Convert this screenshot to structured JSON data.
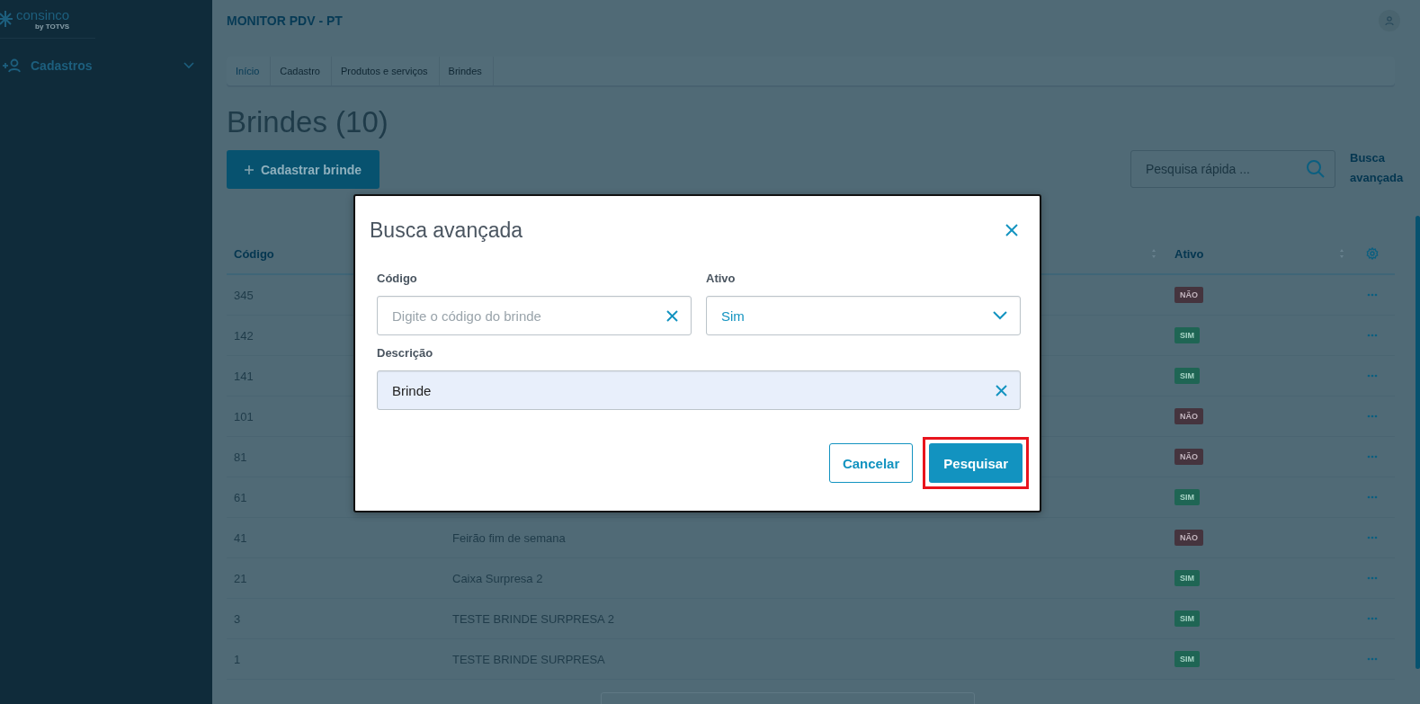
{
  "sidebar": {
    "logo": "consinco",
    "logo_by": "by",
    "logo_brand": "TOTVS",
    "items": [
      {
        "label": "Cadastros",
        "expanded": false
      }
    ]
  },
  "header": {
    "title": "MONITOR PDV - PT"
  },
  "breadcrumb": [
    "Início",
    "Cadastro",
    "Produtos e serviços",
    "Brindes"
  ],
  "page": {
    "title": "Brindes (10)",
    "add_button": "Cadastrar brinde",
    "search": {
      "placeholder": "Pesquisa rápida ..."
    },
    "advanced_link": "Busca avançada"
  },
  "table": {
    "columns": [
      {
        "label": "Código"
      },
      {
        "label": "Ativo",
        "sortable": true
      }
    ],
    "rows": [
      {
        "code": "345",
        "status": "NÃO",
        "active": false
      },
      {
        "code": "142",
        "status": "SIM",
        "active": true
      },
      {
        "code": "141",
        "status": "SIM",
        "active": true
      },
      {
        "code": "101",
        "status": "NÃO",
        "active": false
      },
      {
        "code": "81",
        "status": "NÃO",
        "active": false
      },
      {
        "code": "61",
        "status": "SIM",
        "active": true
      },
      {
        "code": "41",
        "description": "Feirão fim de semana",
        "status": "NÃO",
        "active": false
      },
      {
        "code": "21",
        "description": "Caixa Surpresa 2",
        "status": "SIM",
        "active": true
      },
      {
        "code": "3",
        "description": "TESTE BRINDE SURPRESA 2",
        "status": "SIM",
        "active": true
      },
      {
        "code": "1",
        "description": "TESTE BRINDE SURPRESA",
        "status": "SIM",
        "active": true
      }
    ]
  },
  "modal": {
    "title": "Busca avançada",
    "fields": [
      {
        "kind": "text",
        "label": "Código",
        "placeholder": "Digite o código do brinde",
        "filled": false
      },
      {
        "kind": "select",
        "label": "Ativo",
        "value": "Sim",
        "filled": false
      },
      {
        "kind": "text",
        "label": "Descrição",
        "value": "Brinde",
        "filled": true
      }
    ],
    "buttons": [
      {
        "label": "Cancelar",
        "kind": "secondary",
        "highlighted": false
      },
      {
        "label": "Pesquisar",
        "kind": "primary",
        "highlighted": true
      }
    ]
  }
}
